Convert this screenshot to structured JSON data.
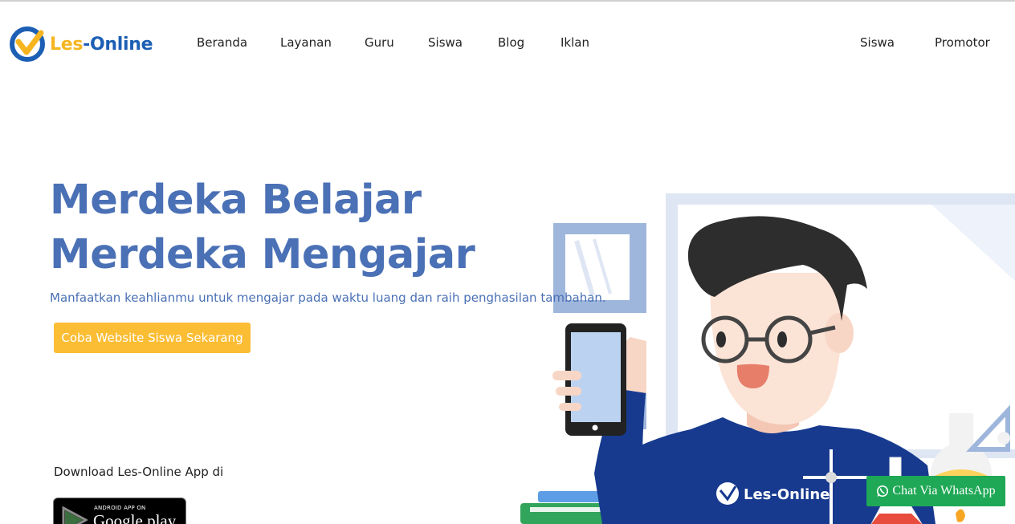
{
  "brand": {
    "les": "Les",
    "online": "-Online"
  },
  "nav": {
    "left": [
      "Beranda",
      "Layanan",
      "Guru",
      "Siswa",
      "Blog",
      "Iklan"
    ],
    "right": [
      "Siswa",
      "Promotor"
    ]
  },
  "hero": {
    "title": "Merdeka Belajar Merdeka Mengajar",
    "subtitle": "Manfaatkan keahlianmu untuk mengajar pada waktu luang dan raih penghasilan tambahan.",
    "cta": "Coba Website Siswa Sekarang"
  },
  "download": {
    "label": "Download Les-Online App di",
    "badge_small": "ANDROID APP ON",
    "badge_big": "Google play"
  },
  "illustration": {
    "shirt_logo": "Les-Online"
  },
  "whatsapp": {
    "label": "Chat Via WhatsApp"
  },
  "colors": {
    "primary": "#4a70b5",
    "accent": "#fbbd33",
    "whatsapp": "#1fa856",
    "logo_blue": "#1c5fb4",
    "logo_yellow": "#f6b51f"
  },
  "icons": {
    "logo": "checkmark-circle-logo",
    "store": "google-play-icon",
    "chat": "whatsapp-icon"
  }
}
